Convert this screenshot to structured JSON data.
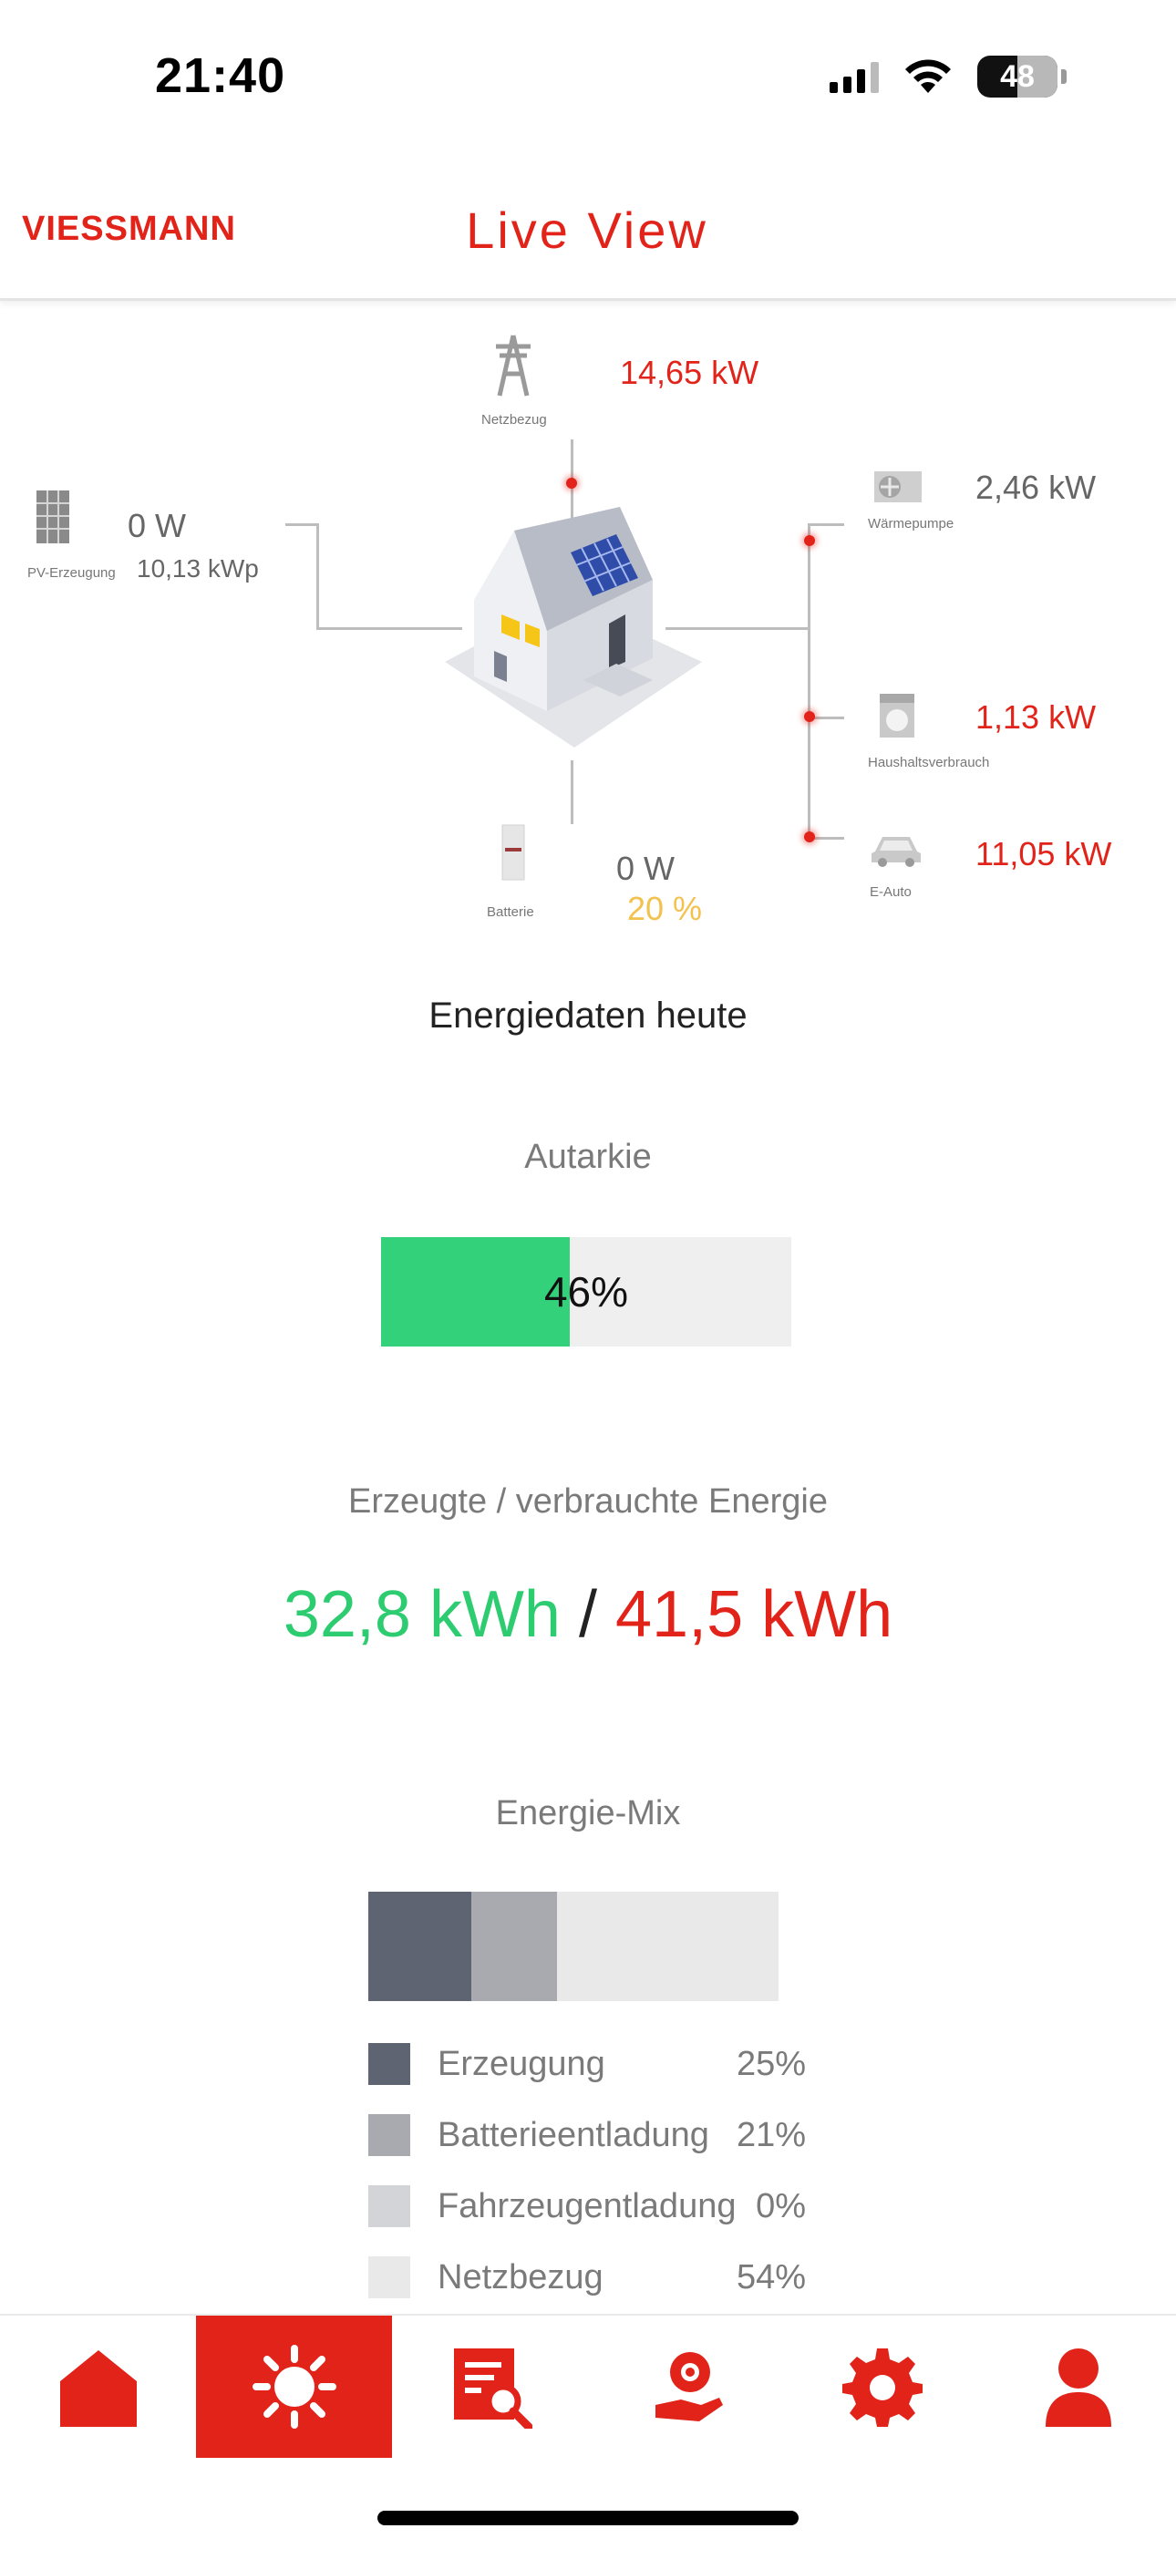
{
  "status_bar": {
    "time": "21:40",
    "battery": "48"
  },
  "header": {
    "logo": "VIESSMANN",
    "title": "Live View"
  },
  "diagram": {
    "grid": {
      "label": "Netzbezug",
      "value": "14,65 kW"
    },
    "pv": {
      "label": "PV-Erzeugung",
      "value": "0 W",
      "capacity": "10,13 kWp"
    },
    "heat_pump": {
      "label": "Wärmepumpe",
      "value": "2,46 kW"
    },
    "household": {
      "label": "Haushaltsverbrauch",
      "value": "1,13 kW"
    },
    "ev": {
      "label": "E-Auto",
      "value": "11,05 kW"
    },
    "battery": {
      "label": "Batterie",
      "value": "0 W",
      "soc": "20 %"
    }
  },
  "energy_today": {
    "title": "Energiedaten heute",
    "autarky": {
      "title": "Autarkie",
      "value_text": "46%",
      "fraction": 0.46
    },
    "energy": {
      "title": "Erzeugte / verbrauchte Energie",
      "produced": "32,8 kWh",
      "separator": "/",
      "consumed": "41,5 kWh"
    },
    "mix": {
      "title": "Energie-Mix",
      "items": [
        {
          "label": "Erzeugung",
          "value": "25%",
          "fraction": 0.25,
          "color": "#5f6472"
        },
        {
          "label": "Batterieentladung",
          "value": "21%",
          "fraction": 0.21,
          "color": "#a8aab0"
        },
        {
          "label": "Fahrzeugentladung",
          "value": "0%",
          "fraction": 0.0,
          "color": "#d3d4d7"
        },
        {
          "label": "Netzbezug",
          "value": "54%",
          "fraction": 0.54,
          "color": "#e9e9e9"
        }
      ]
    }
  },
  "nav": {
    "icons": [
      "home-icon",
      "sun-icon",
      "report-search-icon",
      "hand-coin-icon",
      "gear-icon",
      "user-icon"
    ],
    "active": 1
  },
  "colors": {
    "accent": "#e2231a",
    "green": "#33d17a",
    "yellow": "#f2c14e"
  }
}
